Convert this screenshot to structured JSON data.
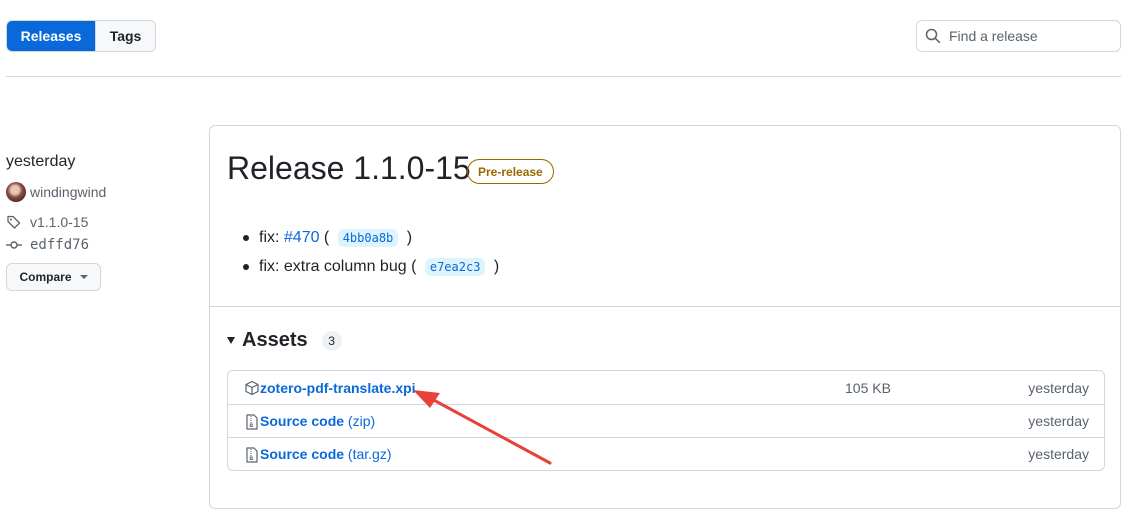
{
  "nav": {
    "releases_label": "Releases",
    "tags_label": "Tags"
  },
  "search": {
    "placeholder": "Find a release"
  },
  "sidebar": {
    "date": "yesterday",
    "author": "windingwind",
    "tag": "v1.1.0-15",
    "commit": "edffd76",
    "compare_label": "Compare"
  },
  "release": {
    "title": "Release 1.1.0-15",
    "badge": "Pre-release",
    "notes": [
      {
        "prefix": "fix: ",
        "link": "#470",
        "open": " ( ",
        "sha": "4bb0a8b",
        "close": " )"
      },
      {
        "prefix": "fix: extra column bug",
        "open": " ( ",
        "sha": "e7ea2c3",
        "close": " )"
      }
    ]
  },
  "assets": {
    "heading": "Assets",
    "count": "3",
    "items": [
      {
        "name": "zotero-pdf-translate.xpi",
        "suffix": "",
        "size": "105 KB",
        "date": "yesterday",
        "icon": "package-icon"
      },
      {
        "name": "Source code",
        "suffix": " (zip)",
        "size": "",
        "date": "yesterday",
        "icon": "file-zip-icon"
      },
      {
        "name": "Source code",
        "suffix": " (tar.gz)",
        "size": "",
        "date": "yesterday",
        "icon": "file-zip-icon"
      }
    ]
  },
  "colors": {
    "accent": "#0969da",
    "prerelease": "#9a6700",
    "annotation_arrow": "#e8413a"
  }
}
